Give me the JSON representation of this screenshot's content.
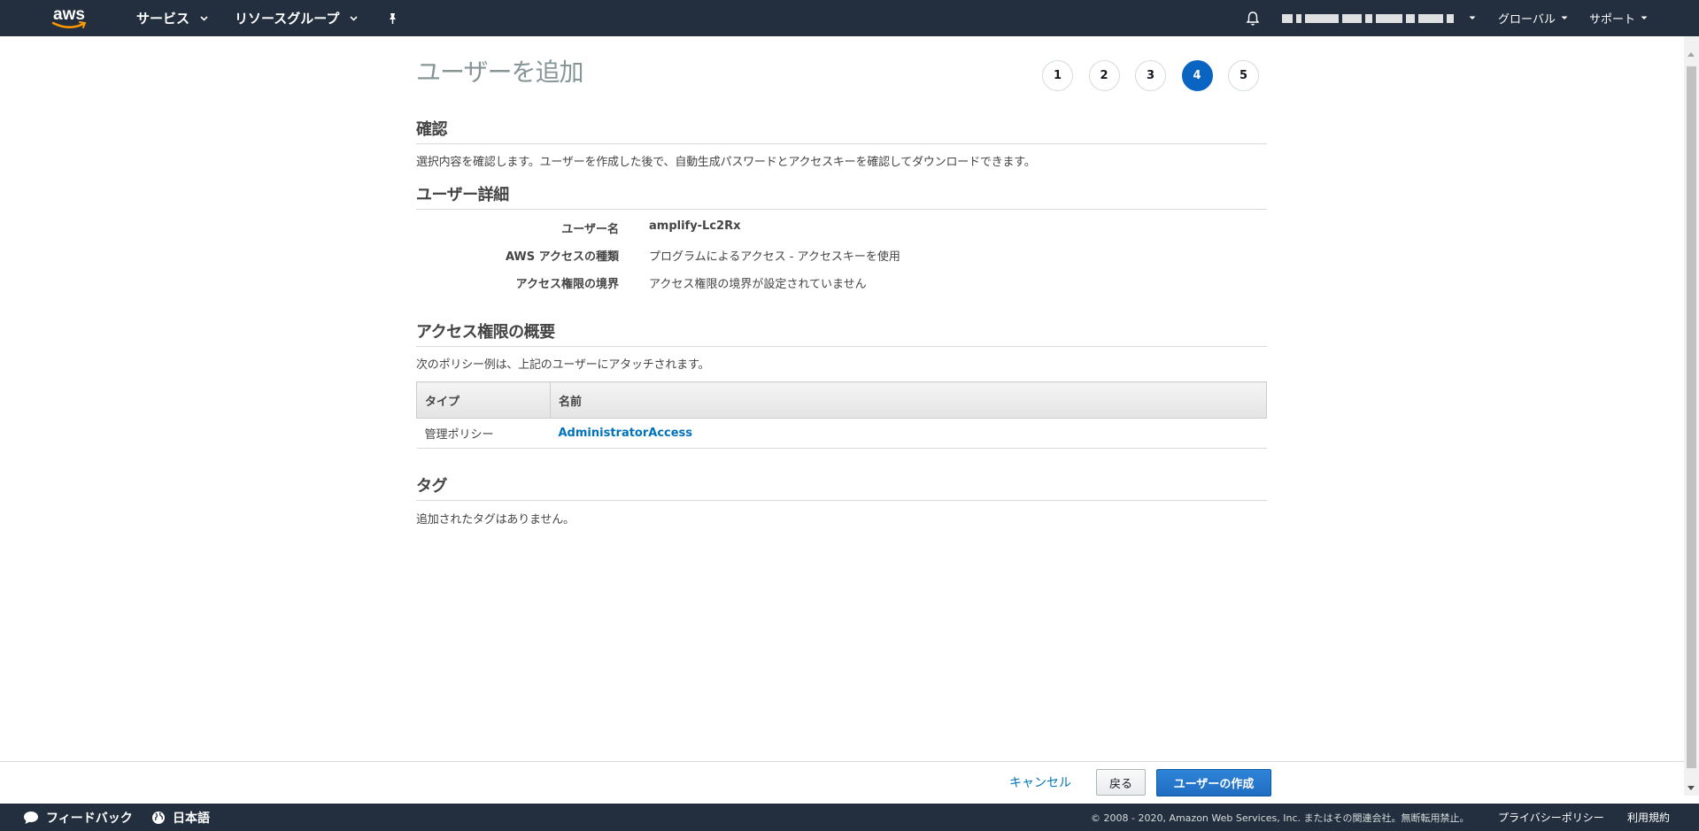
{
  "topnav": {
    "logo_text": "aws",
    "services_label": "サービス",
    "resource_groups_label": "リソースグループ",
    "pin_icon": "pin-icon",
    "bell_icon": "bell-icon",
    "region_label": "グローバル",
    "support_label": "サポート"
  },
  "page": {
    "title": "ユーザーを追加",
    "steps": [
      "1",
      "2",
      "3",
      "4",
      "5"
    ],
    "active_step": "4"
  },
  "review": {
    "title": "確認",
    "description": "選択内容を確認します。ユーザーを作成した後で、自動生成パスワードとアクセスキーを確認してダウンロードできます。"
  },
  "user_details": {
    "title": "ユーザー詳細",
    "rows": [
      {
        "label": "ユーザー名",
        "value": "amplify-Lc2Rx"
      },
      {
        "label": "AWS アクセスの種類",
        "value": "プログラムによるアクセス - アクセスキーを使用"
      },
      {
        "label": "アクセス権限の境界",
        "value": "アクセス権限の境界が設定されていません"
      }
    ]
  },
  "permissions": {
    "title": "アクセス権限の概要",
    "description": "次のポリシー例は、上記のユーザーにアタッチされます。",
    "columns": [
      "タイプ",
      "名前"
    ],
    "rows": [
      {
        "type": "管理ポリシー",
        "name": "AdministratorAccess"
      }
    ]
  },
  "tags": {
    "title": "タグ",
    "empty_message": "追加されたタグはありません。"
  },
  "actions": {
    "cancel": "キャンセル",
    "back": "戻る",
    "create": "ユーザーの作成"
  },
  "footer": {
    "feedback": "フィードバック",
    "language": "日本語",
    "copyright": "© 2008 - 2020, Amazon Web Services, Inc. またはその関連会社。無断転用禁止。",
    "privacy": "プライバシーポリシー",
    "terms": "利用規約"
  },
  "colors": {
    "nav_bg": "#232f3e",
    "active_step": "#0a64c2",
    "link": "#0073bb",
    "primary_button": "#1f6dc2"
  }
}
